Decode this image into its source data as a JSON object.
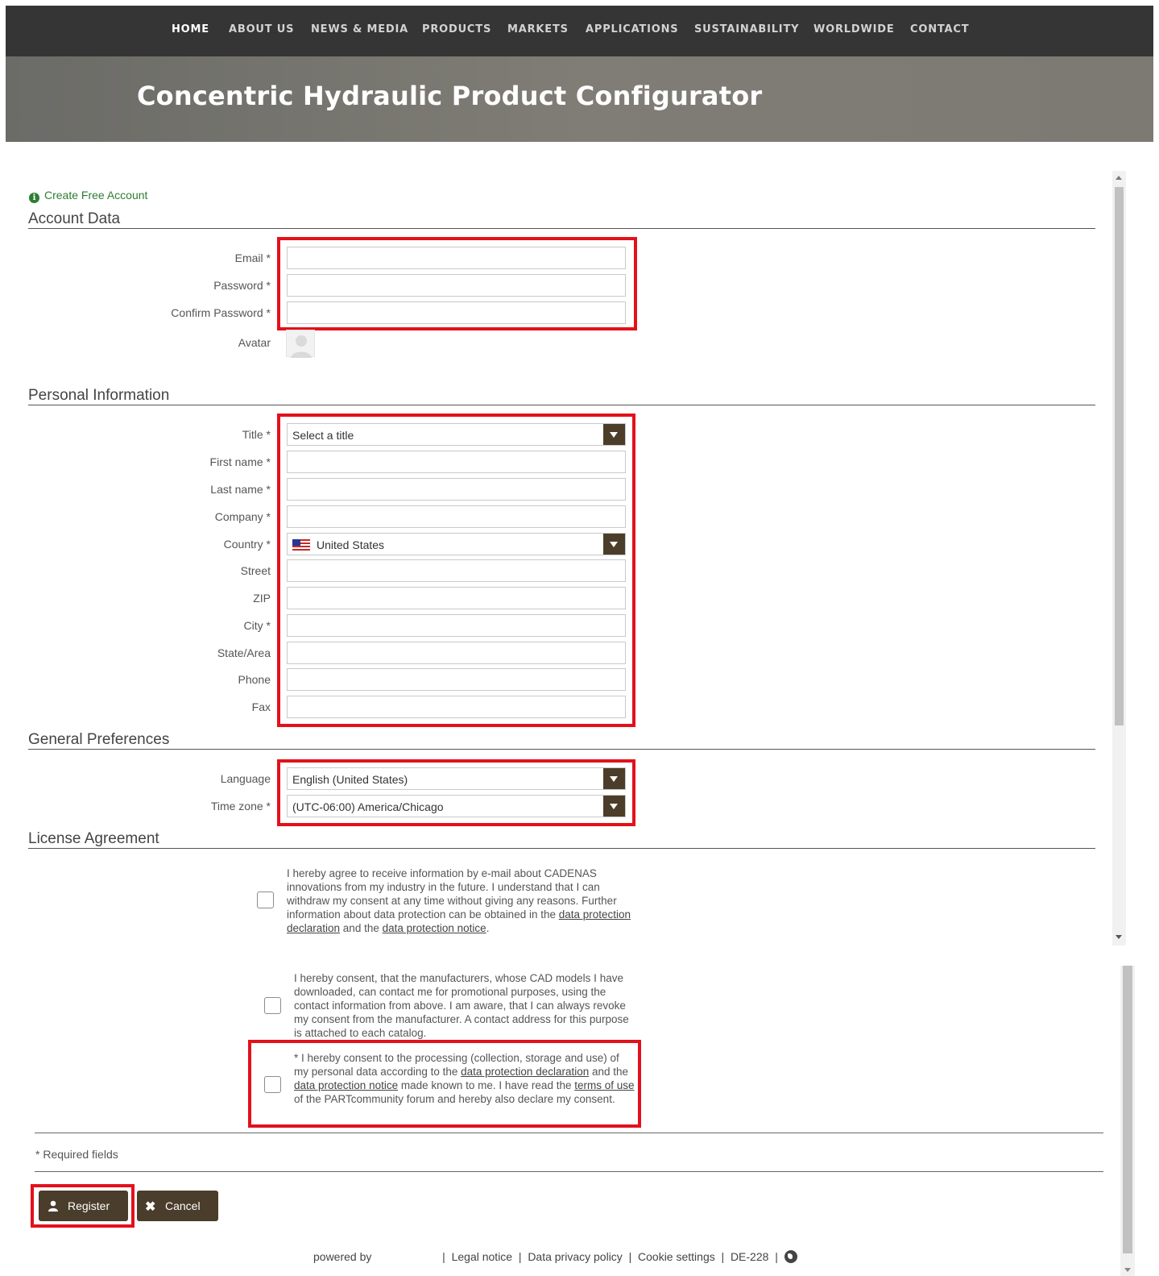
{
  "nav": {
    "items": [
      {
        "label": "HOME",
        "active": true
      },
      {
        "label": "ABOUT US"
      },
      {
        "label": "NEWS & MEDIA"
      },
      {
        "label": "PRODUCTS"
      },
      {
        "label": "MARKETS"
      },
      {
        "label": "APPLICATIONS"
      },
      {
        "label": "SUSTAINABILITY"
      },
      {
        "label": "WORLDWIDE"
      },
      {
        "label": "CONTACT"
      }
    ]
  },
  "banner": {
    "title": "Concentric Hydraulic Product Configurator"
  },
  "create_account": {
    "label": "Create Free Account",
    "icon": "info-icon"
  },
  "account": {
    "title": "Account Data",
    "email_label": "Email *",
    "password_label": "Password *",
    "confirm_label": "Confirm Password *",
    "avatar_label": "Avatar"
  },
  "personal": {
    "title": "Personal Information",
    "title_label": "Title *",
    "title_value": "Select a title",
    "first_label": "First name *",
    "last_label": "Last name *",
    "company_label": "Company *",
    "country_label": "Country *",
    "country_value": "United States",
    "street_label": "Street",
    "zip_label": "ZIP",
    "city_label": "City *",
    "state_label": "State/Area",
    "phone_label": "Phone",
    "fax_label": "Fax"
  },
  "preferences": {
    "title": "General Preferences",
    "language_label": "Language",
    "language_value": "English (United States)",
    "timezone_label": "Time zone *",
    "timezone_value": "(UTC-06:00) America/Chicago"
  },
  "license": {
    "title": "License Agreement",
    "consent1": {
      "text_a": "I hereby agree to receive information by e-mail about CADENAS innovations from my industry in the future. I understand that I can withdraw my consent at any time without giving any reasons. Further information about data protection can be obtained in the ",
      "link1": "data protection declaration",
      "text_b": " and the ",
      "link2": "data protection notice",
      "text_c": "."
    },
    "consent2": {
      "text": "I hereby consent, that the manufacturers, whose CAD models I have downloaded, can contact me for promotional purposes, using the contact information from above. I am aware, that I can always revoke my consent from the manufacturer. A contact address for this purpose is attached to each catalog."
    },
    "consent3": {
      "text_a": "* I hereby consent to the processing (collection, storage and use) of my personal data according to the ",
      "link1": "data protection declaration",
      "text_b": " and the ",
      "link2": "data protection notice",
      "text_c": " made known to me. I have read the ",
      "link3": "terms of use",
      "text_d": " of the PARTcommunity forum and hereby also declare my consent."
    }
  },
  "required_note": "* Required fields",
  "buttons": {
    "register": "Register",
    "register_icon": "user-icon",
    "cancel": "Cancel",
    "cancel_icon": "close-icon"
  },
  "footer": {
    "powered_by": "powered by",
    "sep": "|",
    "legal": "Legal notice",
    "privacy": "Data privacy policy",
    "cookies": "Cookie settings",
    "server": "DE-228",
    "globe_icon": "globe-icon"
  },
  "colors": {
    "nav_bg": "#353535",
    "accent_brown": "#4b3d2b",
    "highlight_red": "#e3111b",
    "link_green": "#2e7d32"
  }
}
